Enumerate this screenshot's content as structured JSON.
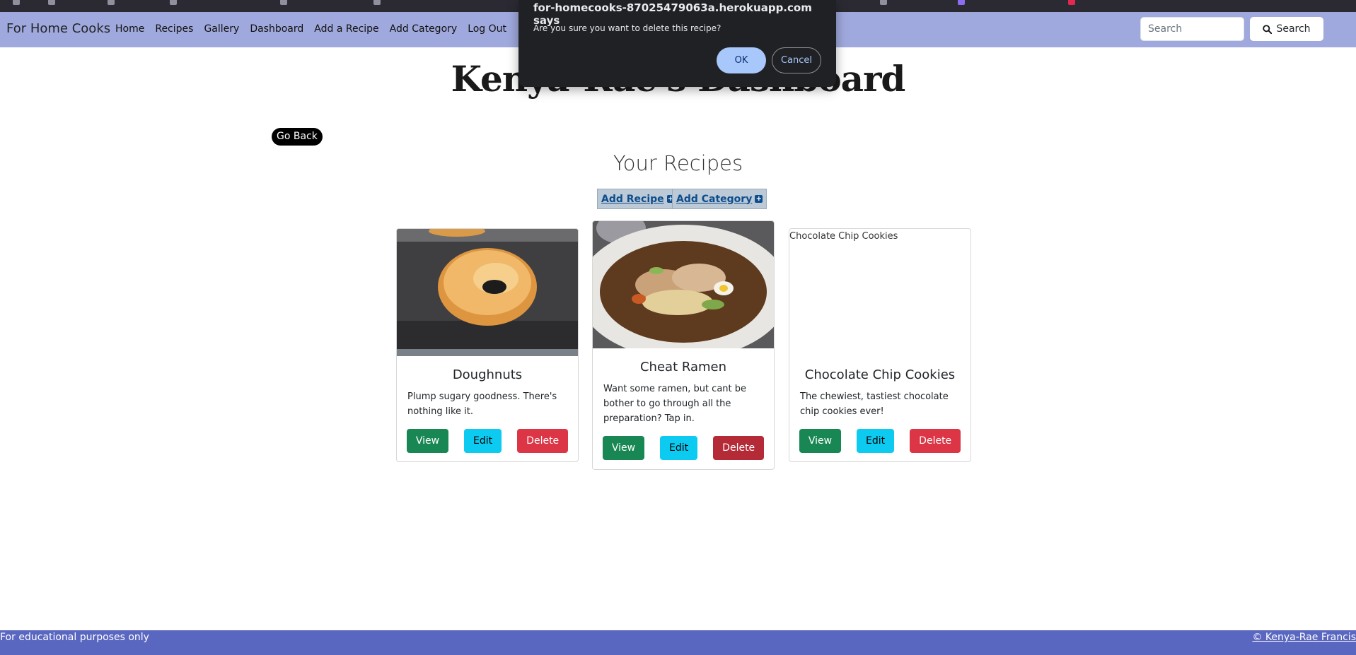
{
  "navbar": {
    "brand": "For Home Cooks",
    "links": [
      "Home",
      "Recipes",
      "Gallery",
      "Dashboard",
      "Add a Recipe",
      "Add Category",
      "Log Out"
    ],
    "search_placeholder": "Search",
    "search_button": "Search"
  },
  "page": {
    "title": "Kenya-Rae's Dashboard",
    "go_back": "Go Back",
    "section_title": "Your Recipes",
    "add_recipe": "Add Recipe",
    "add_category": "Add Category"
  },
  "recipes": [
    {
      "title": "Doughnuts",
      "description": "Plump sugary goodness. There's nothing like it.",
      "view": "View",
      "edit": "Edit",
      "delete": "Delete"
    },
    {
      "title": "Cheat Ramen",
      "description": "Want some ramen, but cant be bother to go through all the preparation? Tap in.",
      "view": "View",
      "edit": "Edit",
      "delete": "Delete"
    },
    {
      "title": "Chocolate Chip Cookies",
      "image_alt": "Chocolate Chip Cookies",
      "description": "The chewiest, tastiest chocolate chip cookies ever!",
      "view": "View",
      "edit": "Edit",
      "delete": "Delete"
    }
  ],
  "footer": {
    "left": "For educational purposes only",
    "right": "© Kenya-Rae Francis"
  },
  "dialog": {
    "title": "for-homecooks-87025479063a.herokuapp.com says",
    "message": "Are you sure you want to delete this recipe?",
    "ok": "OK",
    "cancel": "Cancel"
  },
  "colors": {
    "navbar": "#a0a9dd",
    "footer": "#5a67c0",
    "view": "#198754",
    "edit": "#0dcaf0",
    "delete": "#dc3545"
  }
}
